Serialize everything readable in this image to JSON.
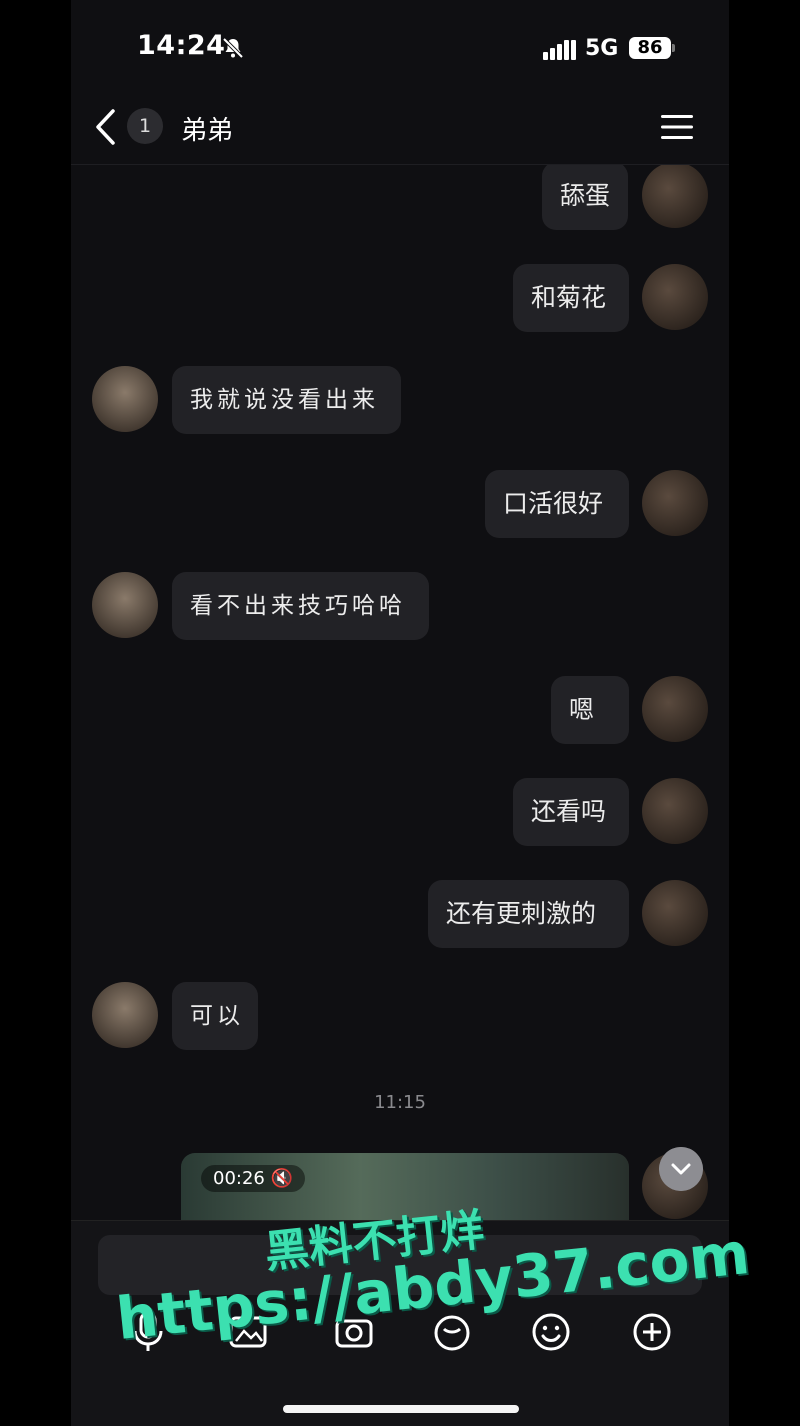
{
  "status_bar": {
    "time": "14:24",
    "network": "5G",
    "battery": "86"
  },
  "header": {
    "unread_count": "1",
    "title": "弟弟"
  },
  "messages": [
    {
      "side": "me",
      "text": "舔蛋"
    },
    {
      "side": "me",
      "text": "和菊花"
    },
    {
      "side": "them",
      "text": "我就说没看出来"
    },
    {
      "side": "me",
      "text": "口活很好"
    },
    {
      "side": "them",
      "text": "看不出来技巧哈哈"
    },
    {
      "side": "me",
      "text": "嗯"
    },
    {
      "side": "me",
      "text": "还看吗"
    },
    {
      "side": "me",
      "text": "还有更刺激的"
    },
    {
      "side": "them",
      "text": "可以"
    }
  ],
  "timestamp": "11:15",
  "video_message": {
    "duration": "00:26"
  },
  "toolbar": {
    "icons": [
      "microphone-icon",
      "image-icon",
      "camera-icon",
      "red-packet-icon",
      "emoji-icon",
      "plus-icon"
    ]
  },
  "watermark": {
    "line1": "黑料不打烊",
    "line2": "https://abdy37.com"
  }
}
